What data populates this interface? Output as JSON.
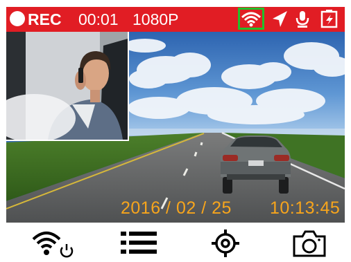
{
  "status_bar": {
    "rec_label": "REC",
    "rec_time": "00:01",
    "resolution": "1080P",
    "icons": [
      "wifi-icon",
      "gps-navigation-icon",
      "microphone-icon",
      "battery-charging-icon"
    ],
    "wifi_highlight_color": "#22c02a",
    "bar_color": "#e11d24"
  },
  "overlay": {
    "date": "2016 / 02 / 25",
    "time": "10:13:45",
    "color": "#f7a51c"
  },
  "toolbar": {
    "buttons": [
      "wifi-power-icon",
      "menu-icon",
      "settings-icon",
      "camera-icon"
    ]
  }
}
